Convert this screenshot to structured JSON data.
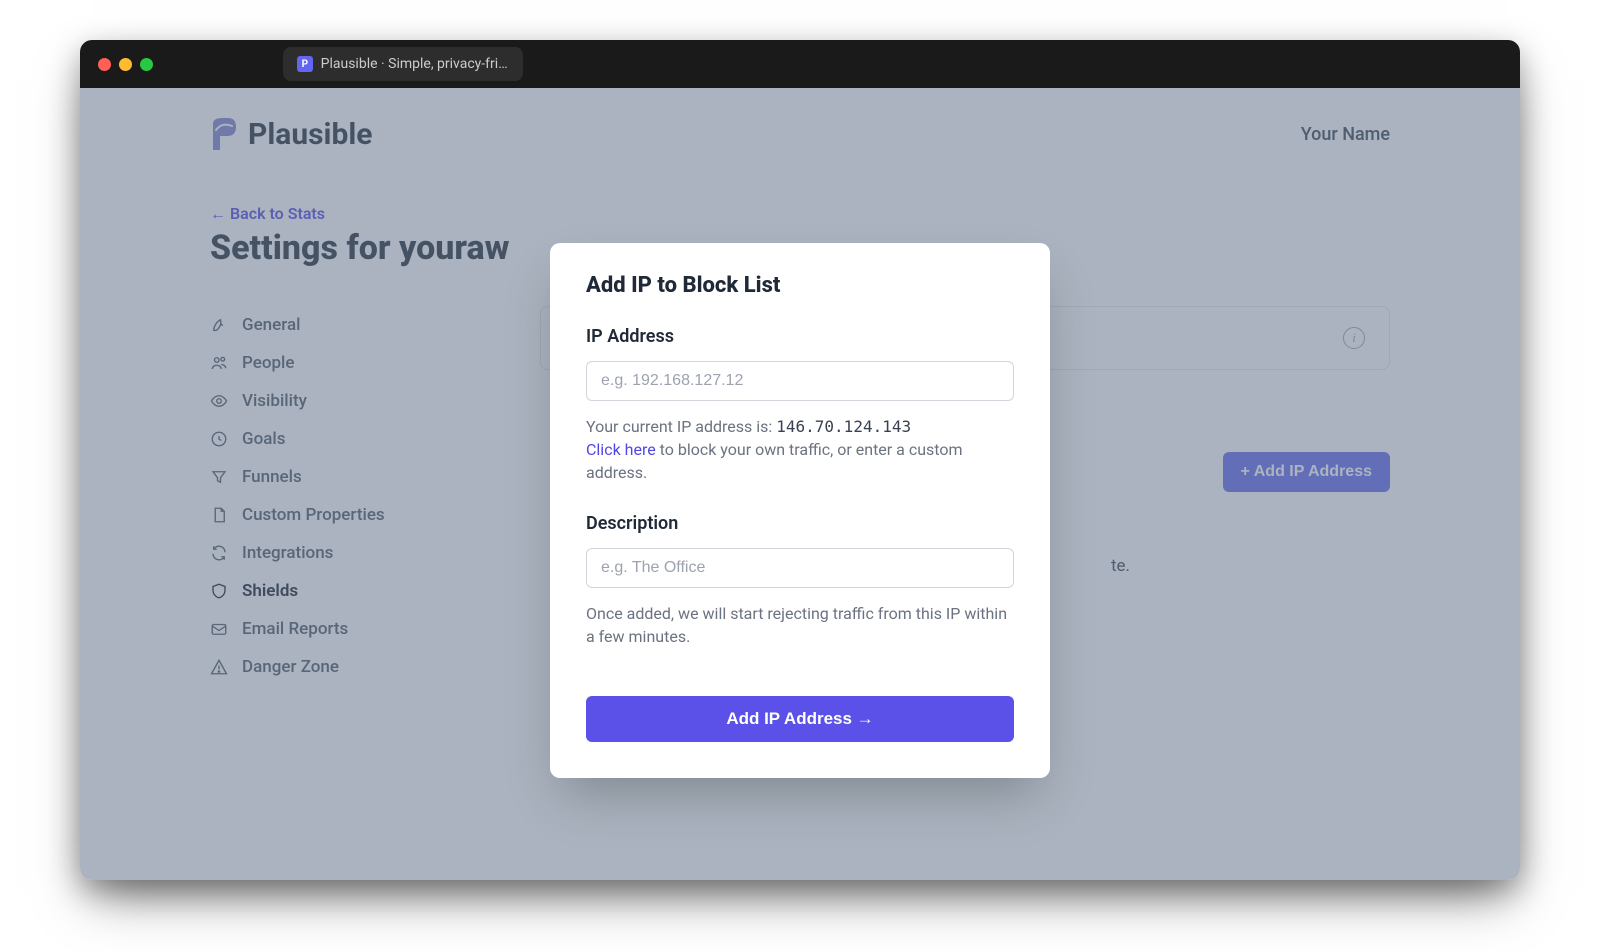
{
  "browser": {
    "tab_title": "Plausible · Simple, privacy-frien"
  },
  "header": {
    "brand": "Plausible",
    "user_name": "Your Name"
  },
  "page": {
    "back_link": "← Back to Stats",
    "title": "Settings for youraw",
    "info_char": "i"
  },
  "sidenav": {
    "items": [
      {
        "label": "General",
        "icon": "rocket"
      },
      {
        "label": "People",
        "icon": "users"
      },
      {
        "label": "Visibility",
        "icon": "eye"
      },
      {
        "label": "Goals",
        "icon": "target"
      },
      {
        "label": "Funnels",
        "icon": "funnel"
      },
      {
        "label": "Custom Properties",
        "icon": "document"
      },
      {
        "label": "Integrations",
        "icon": "refresh"
      },
      {
        "label": "Shields",
        "icon": "shield"
      },
      {
        "label": "Email Reports",
        "icon": "mail"
      },
      {
        "label": "Danger Zone",
        "icon": "warning"
      }
    ]
  },
  "panel": {
    "add_button": "+ Add IP Address",
    "description_tail": "te."
  },
  "modal": {
    "title": "Add IP to Block List",
    "ip_label": "IP Address",
    "ip_placeholder": "e.g. 192.168.127.12",
    "current_ip_prefix": "Your current IP address is: ",
    "current_ip": "146.70.124.143",
    "click_here": "Click here",
    "block_own_suffix": " to block your own traffic, or enter a custom address.",
    "desc_label": "Description",
    "desc_placeholder": "e.g. The Office",
    "note": "Once added, we will start rejecting traffic from this IP within a few minutes.",
    "submit": "Add IP Address →"
  }
}
